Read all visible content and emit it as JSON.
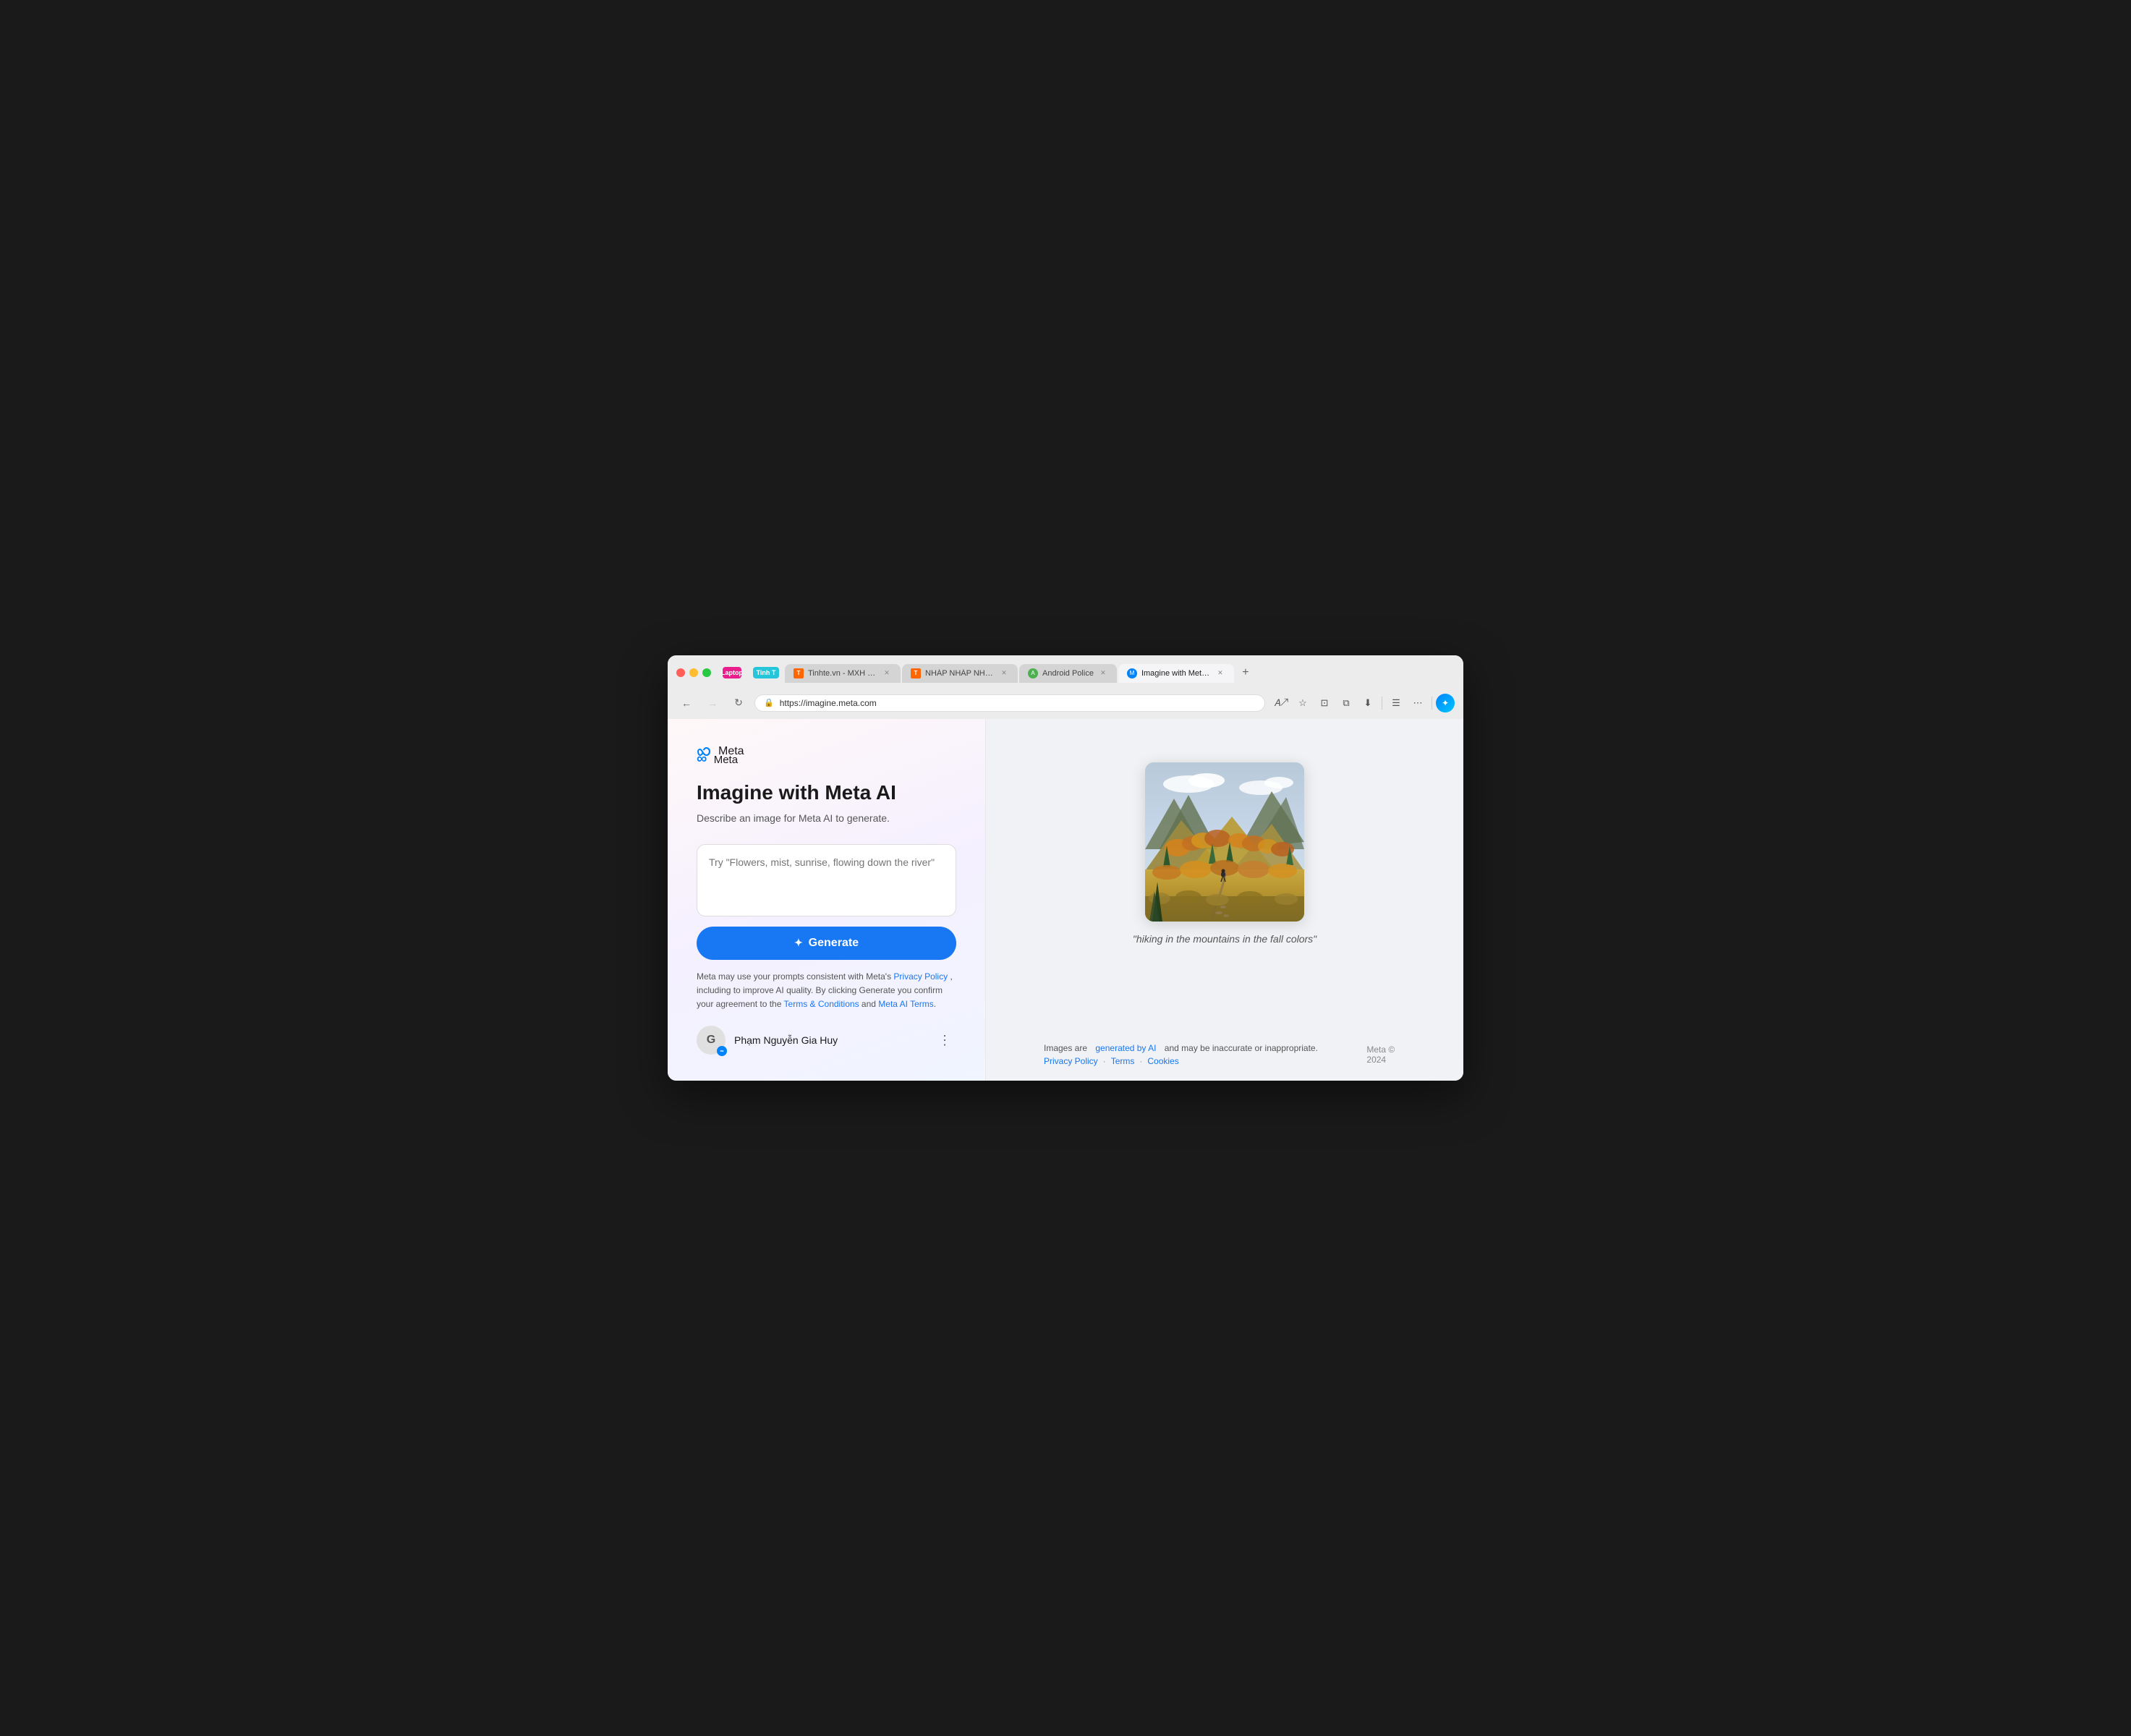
{
  "browser": {
    "url": "https://imagine.meta.com",
    "tabs": [
      {
        "label": "Tinhte.vn - MXH Hỏi đáp, Rev...",
        "favicon_color": "#ff6600",
        "favicon_char": "T",
        "active": false,
        "closeable": true
      },
      {
        "label": "NHÁP NHÁP NHÁP | Tinhte.vn",
        "favicon_color": "#ff6600",
        "favicon_char": "T",
        "active": false,
        "closeable": true
      },
      {
        "label": "Android Police",
        "favicon_color": "#4caf50",
        "favicon_char": "A",
        "active": false,
        "closeable": true
      },
      {
        "label": "Imagine with Meta AI",
        "favicon_color": "#0082fb",
        "favicon_char": "M",
        "active": true,
        "closeable": true
      }
    ],
    "profile_label": "Laptop",
    "profile2_label": "Tinh T",
    "toolbar": {
      "back_title": "Back",
      "forward_title": "Forward",
      "refresh_title": "Refresh",
      "bookmark_title": "Bookmark",
      "more_title": "More options"
    }
  },
  "page": {
    "meta_logo_text": "Meta",
    "title": "Imagine with Meta AI",
    "subtitle": "Describe an image for Meta AI to generate.",
    "textarea_placeholder": "Try \"Flowers, mist, sunrise, flowing down the river\"",
    "generate_button": "Generate",
    "legal_text_before": "Meta may use your prompts consistent with Meta's",
    "legal_privacy": "Privacy Policy",
    "legal_text_middle": ", including to improve AI quality. By clicking Generate you confirm your agreement to the",
    "legal_terms": "Terms & Conditions",
    "legal_and": "and",
    "legal_meta_terms": "Meta AI Terms",
    "legal_period": "."
  },
  "user": {
    "name": "Phạm Nguyễn Gia Huy",
    "avatar_char": "G"
  },
  "generated": {
    "caption": "\"hiking in the mountains in the fall colors\""
  },
  "footer": {
    "images_text": "Images are",
    "generated_link": "generated by AI",
    "inaccurate_text": "and may be inaccurate or inappropriate.",
    "privacy_link": "Privacy Policy",
    "terms_link": "Terms",
    "cookies_link": "Cookies",
    "copyright": "Meta © 2024"
  }
}
